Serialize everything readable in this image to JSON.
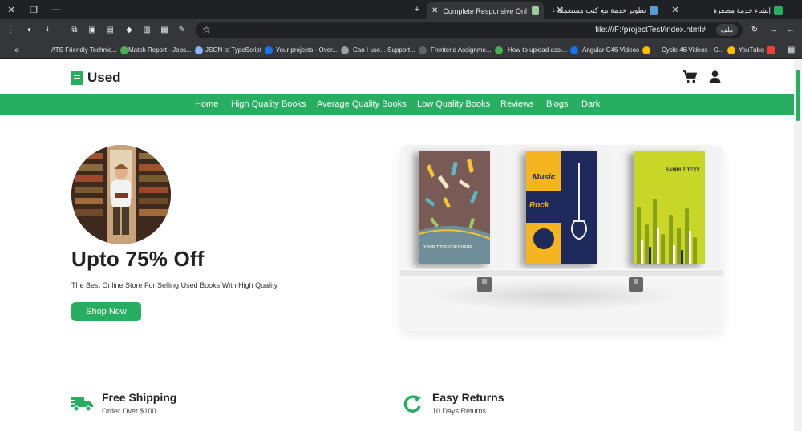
{
  "browser": {
    "tabs": [
      {
        "title": "Complete Responsive Online B",
        "active": true
      },
      {
        "title": "تطوير خدمة بيع كتب مستعملة عا",
        "active": false
      },
      {
        "title": "إنشاء خدمة مصغرة",
        "active": false
      }
    ],
    "url": "file:///F:/projectTest/index.html#",
    "url_chip": "ملف",
    "bookmarks": [
      {
        "label": "ATS Friendly Technic...",
        "color": "#4caf50"
      },
      {
        "label": "Match Report - Jobs...",
        "color": "#8ab4f8"
      },
      {
        "label": "JSON to TypeScript",
        "color": "#1a73e8"
      },
      {
        "label": "Your projects - Over...",
        "color": "#9e9e9e"
      },
      {
        "label": "Can I use... Support...",
        "color": "#5f6368"
      },
      {
        "label": "Frontend Assignme...",
        "color": "#4caf50"
      },
      {
        "label": "How to upload assi...",
        "color": "#1a73e8"
      },
      {
        "label": "Angular C46 Videos",
        "color": "#fbbc04"
      },
      {
        "label": "Cycle 46 Videos - G...",
        "color": "#fbbc04"
      },
      {
        "label": "YouTube",
        "color": "#ea4335"
      }
    ],
    "overflow_label": "«"
  },
  "site": {
    "logo": "Used",
    "nav": [
      "Home",
      "High Quality Books",
      "Average Quality Books",
      "Low Quality Books",
      "Reviews",
      "Blogs",
      "Dark"
    ],
    "accent": "#27ae60"
  },
  "hero": {
    "title": "Upto 75% Off",
    "subtitle": "The Best Online Store For Selling Used Books With High Quality",
    "button": "Shop Now"
  },
  "books": [
    {
      "name": "hands-cover",
      "text": "YOUR TITLE GOES HERE",
      "bg": "#7a5a55"
    },
    {
      "name": "music-rock-cover",
      "text": "Music",
      "text2": "Rock",
      "bg": "#1f2a5c"
    },
    {
      "name": "sample-text-cover",
      "text": "SAMPLE TEXT",
      "bg": "#c8d628"
    }
  ],
  "features": [
    {
      "title": "Free Shipping",
      "subtitle": "Order Over $100",
      "icon": "truck-icon"
    },
    {
      "title": "Easy Returns",
      "subtitle": "10 Days Returns",
      "icon": "redo-icon"
    }
  ]
}
